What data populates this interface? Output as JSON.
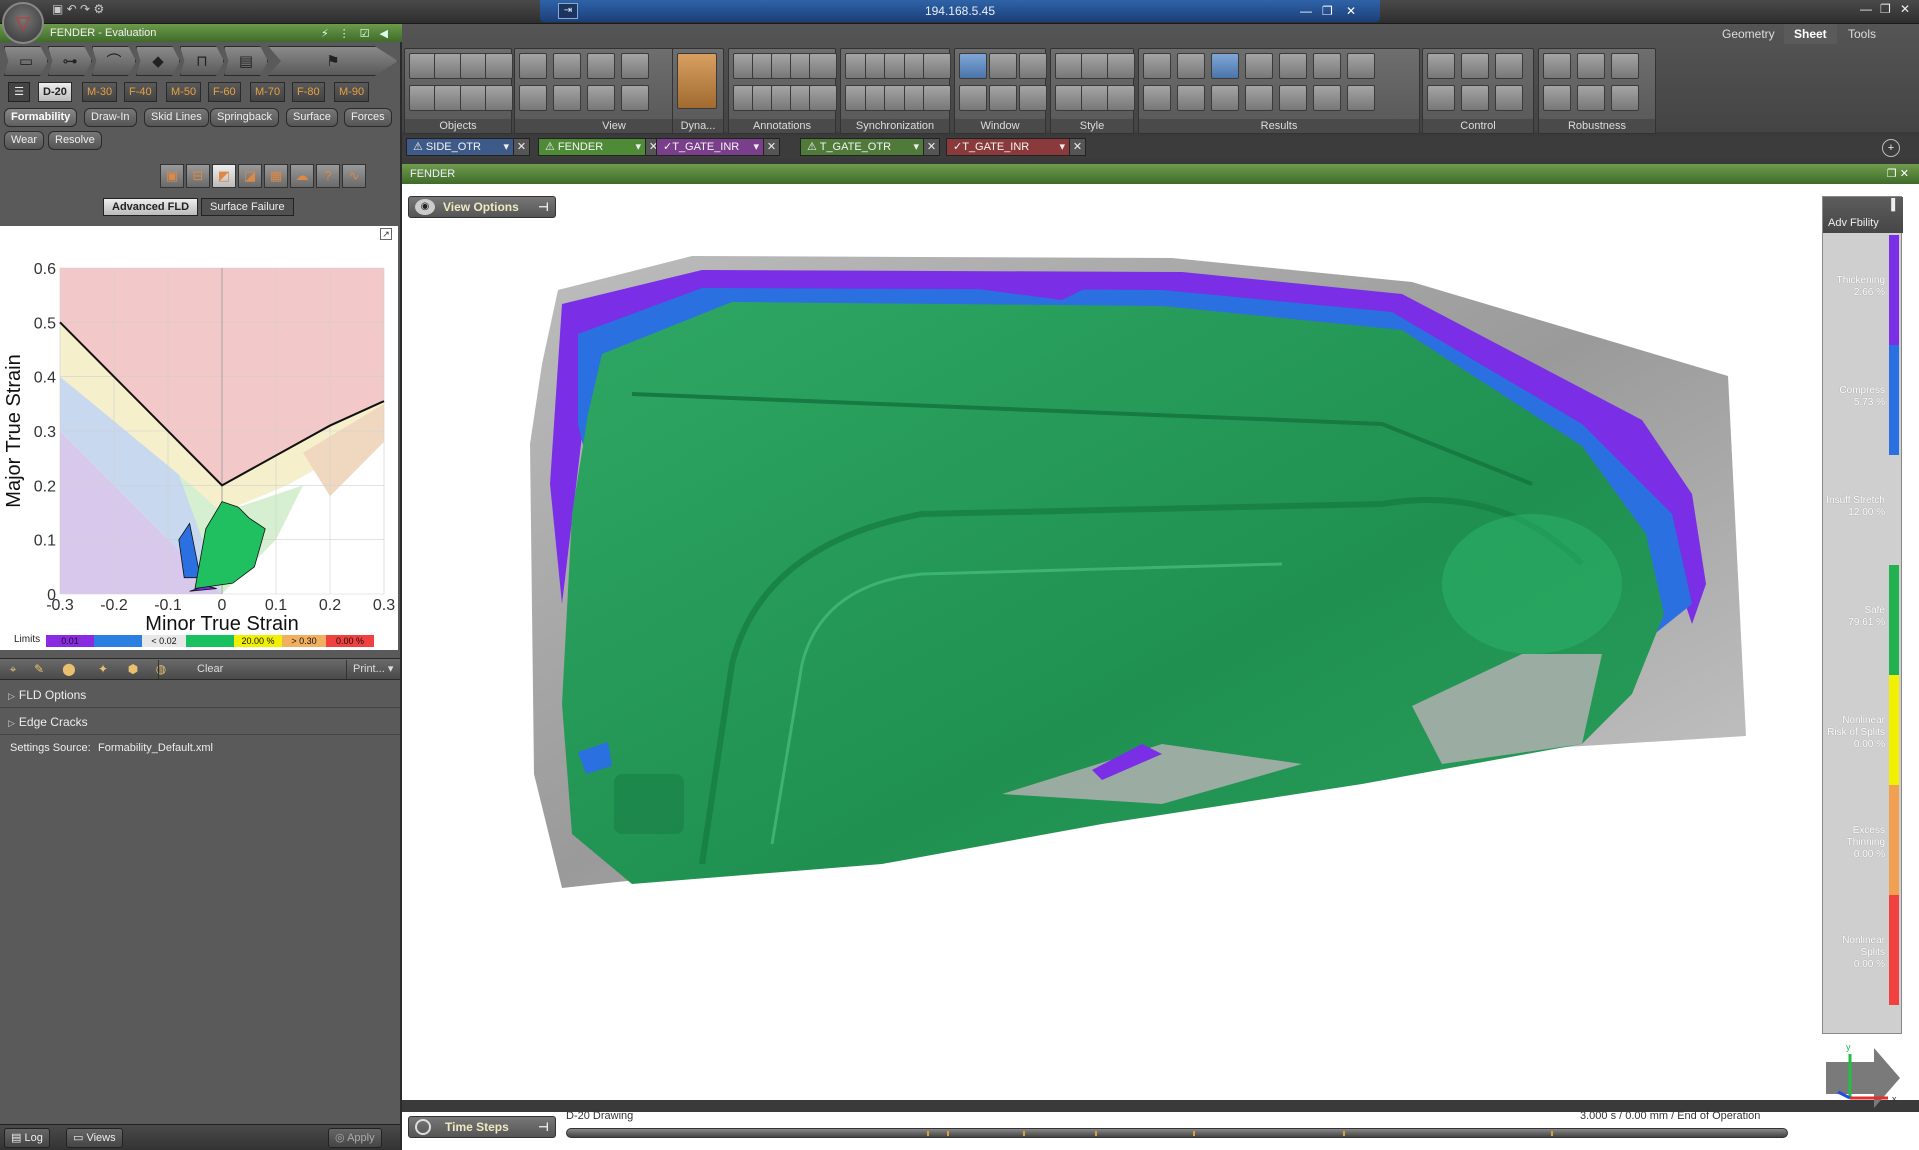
{
  "window": {
    "ip_title": "194.168.5.45",
    "project_title": "FENDER",
    "project_subtitle": "Evaluation"
  },
  "ribbon": {
    "tabs": [
      {
        "label": "Geometry",
        "active": false
      },
      {
        "label": "Sheet",
        "active": true
      },
      {
        "label": "Tools",
        "active": false
      }
    ],
    "groups": [
      "Objects",
      "View",
      "Dyna...",
      "Annotations",
      "Synchronization",
      "Window",
      "Style",
      "Results",
      "Control",
      "Robustness"
    ]
  },
  "operations": [
    "D-20",
    "M-30",
    "F-40",
    "M-50",
    "F-60",
    "M-70",
    "F-80",
    "M-90"
  ],
  "active_operation": "D-20",
  "result_modes": {
    "row1": [
      "Formability",
      "Draw-In",
      "Skid Lines",
      "Springback",
      "Surface",
      "Forces"
    ],
    "row2": [
      "Wear",
      "Resolve"
    ],
    "active": "Formability"
  },
  "fld_tabs": [
    "Advanced FLD",
    "Surface Failure"
  ],
  "chart_data": {
    "type": "scatter",
    "title": "",
    "xlabel": "Minor True Strain",
    "ylabel": "Major True Strain",
    "xlim": [
      -0.3,
      0.3
    ],
    "ylim": [
      0,
      0.6
    ],
    "xticks": [
      "-0.3",
      "-0.2",
      "-0.1",
      "0",
      "0.1",
      "0.2",
      "0.3"
    ],
    "yticks": [
      "0",
      "0.1",
      "0.2",
      "0.3",
      "0.4",
      "0.5",
      "0.6"
    ],
    "flc_curve": {
      "x": [
        -0.3,
        -0.15,
        0.0,
        0.2,
        0.3
      ],
      "y": [
        0.5,
        0.35,
        0.2,
        0.31,
        0.355
      ]
    },
    "zones": [
      {
        "name": "Nonlinear Splits",
        "color": "#f2c8c8"
      },
      {
        "name": "Nonlinear Risk of Splits",
        "color": "#f6efcc"
      },
      {
        "name": "Excess Thinning",
        "color": "#f0d8c0"
      },
      {
        "name": "Safe",
        "color": "#d6efd0"
      },
      {
        "name": "Insuff Stretch",
        "color": "#ffffff"
      },
      {
        "name": "Compress",
        "color": "#c8d8ef"
      },
      {
        "name": "Thickening",
        "color": "#d8c8ec"
      }
    ],
    "point_cloud": {
      "safe": {
        "x": [
          -0.05,
          -0.03,
          0.0,
          0.03,
          0.05,
          0.08,
          0.06,
          0.02
        ],
        "y": [
          0.01,
          0.12,
          0.17,
          0.16,
          0.14,
          0.12,
          0.05,
          0.02
        ]
      },
      "compress": {
        "x": [
          -0.07,
          -0.08,
          -0.06,
          -0.04
        ],
        "y": [
          0.03,
          0.1,
          0.13,
          0.03
        ]
      },
      "thickening": {
        "x": [
          -0.06,
          -0.03,
          -0.01
        ],
        "y": [
          0.005,
          0.015,
          0.01
        ]
      }
    }
  },
  "limits": {
    "label": "Limits",
    "items": [
      {
        "text": "0.01",
        "color": "#8a2be2"
      },
      {
        "text": "",
        "color": "#2a7fe0"
      },
      {
        "text": "< 0.02",
        "color": "#e8e8e8"
      },
      {
        "text": "",
        "color": "#18c060"
      },
      {
        "text": "20.00 %",
        "color": "#f0f000"
      },
      {
        "text": "> 0.30",
        "color": "#f0b060"
      },
      {
        "text": "0.00 %",
        "color": "#f04040"
      }
    ]
  },
  "toolbar": {
    "clear": "Clear",
    "print": "Print..."
  },
  "sections": [
    "FLD Options",
    "Edge Cracks"
  ],
  "settings": {
    "label": "Settings Source:",
    "value": "Formability_Default.xml"
  },
  "bottom_left": {
    "log": "Log",
    "views": "Views",
    "apply": "Apply"
  },
  "doc_tabs": [
    {
      "label": "SIDE_OTR",
      "status": "warn",
      "color": "#3d5a88"
    },
    {
      "label": "FENDER",
      "status": "warn",
      "color": "#4f8a36"
    },
    {
      "label": "T_GATE_INR",
      "status": "ok",
      "color": "#7a3f8a"
    },
    {
      "label": "T_GATE_OTR",
      "status": "warn",
      "color": "#4f7a3a"
    },
    {
      "label": "T_GATE_INR",
      "status": "ok",
      "color": "#8a3a3a"
    }
  ],
  "viewport": {
    "title": "FENDER",
    "view_options": "View Options"
  },
  "legend": {
    "title": "Adv Fbility",
    "items": [
      {
        "label": "Thickening",
        "value": "2.66 %",
        "color": "#7a2ee6"
      },
      {
        "label": "Compress",
        "value": "5.73 %",
        "color": "#2a70e0"
      },
      {
        "label": "Insuff Stretch",
        "value": "12.00 %",
        "color": "#cfcfcf"
      },
      {
        "label": "Safe",
        "value": "79.61 %",
        "color": "#22b050"
      },
      {
        "label": "Nonlinear Risk of Splits",
        "value": "0.00 %",
        "color": "#f0f000"
      },
      {
        "label": "Excess Thinning",
        "value": "0.00 %",
        "color": "#f0a050"
      },
      {
        "label": "Nonlinear Splits",
        "value": "0.00 %",
        "color": "#f04040"
      }
    ]
  },
  "timesteps": {
    "button": "Time Steps",
    "label": "D-20 Drawing",
    "time": "3.000 s / 0.00 mm / End of Operation"
  }
}
